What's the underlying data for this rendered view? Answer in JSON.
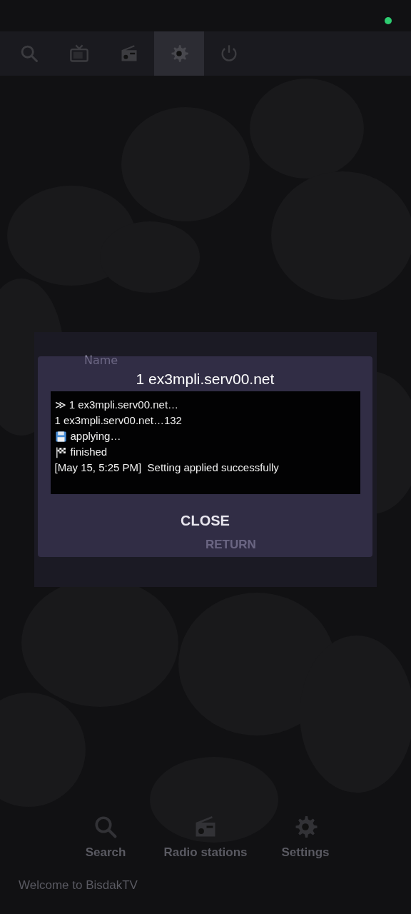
{
  "status": {
    "online": true
  },
  "top_tabs": [
    {
      "kind": "search",
      "selected": false
    },
    {
      "kind": "tv",
      "selected": false
    },
    {
      "kind": "radio",
      "selected": false
    },
    {
      "kind": "settings",
      "selected": true
    },
    {
      "kind": "power",
      "selected": false
    }
  ],
  "background_form": {
    "label": "Name",
    "button": "RETURN"
  },
  "dialog": {
    "title": "1 ex3mpli.serv00.net",
    "log": [
      {
        "kind": "text",
        "text": "≫ 1 ex3mpli.serv00.net…"
      },
      {
        "kind": "text",
        "text": "1 ex3mpli.serv00.net…132"
      },
      {
        "kind": "save",
        "text": "applying…"
      },
      {
        "kind": "flag",
        "text": "finished"
      },
      {
        "kind": "text",
        "text": "[May 15, 5:25 PM]  Setting applied successfully"
      }
    ],
    "close_button": "CLOSE"
  },
  "bottom_nav": [
    {
      "kind": "search",
      "label": "Search"
    },
    {
      "kind": "radio",
      "label": "Radio stations"
    },
    {
      "kind": "settings",
      "label": "Settings"
    }
  ],
  "footer": "Welcome to BisdakTV"
}
